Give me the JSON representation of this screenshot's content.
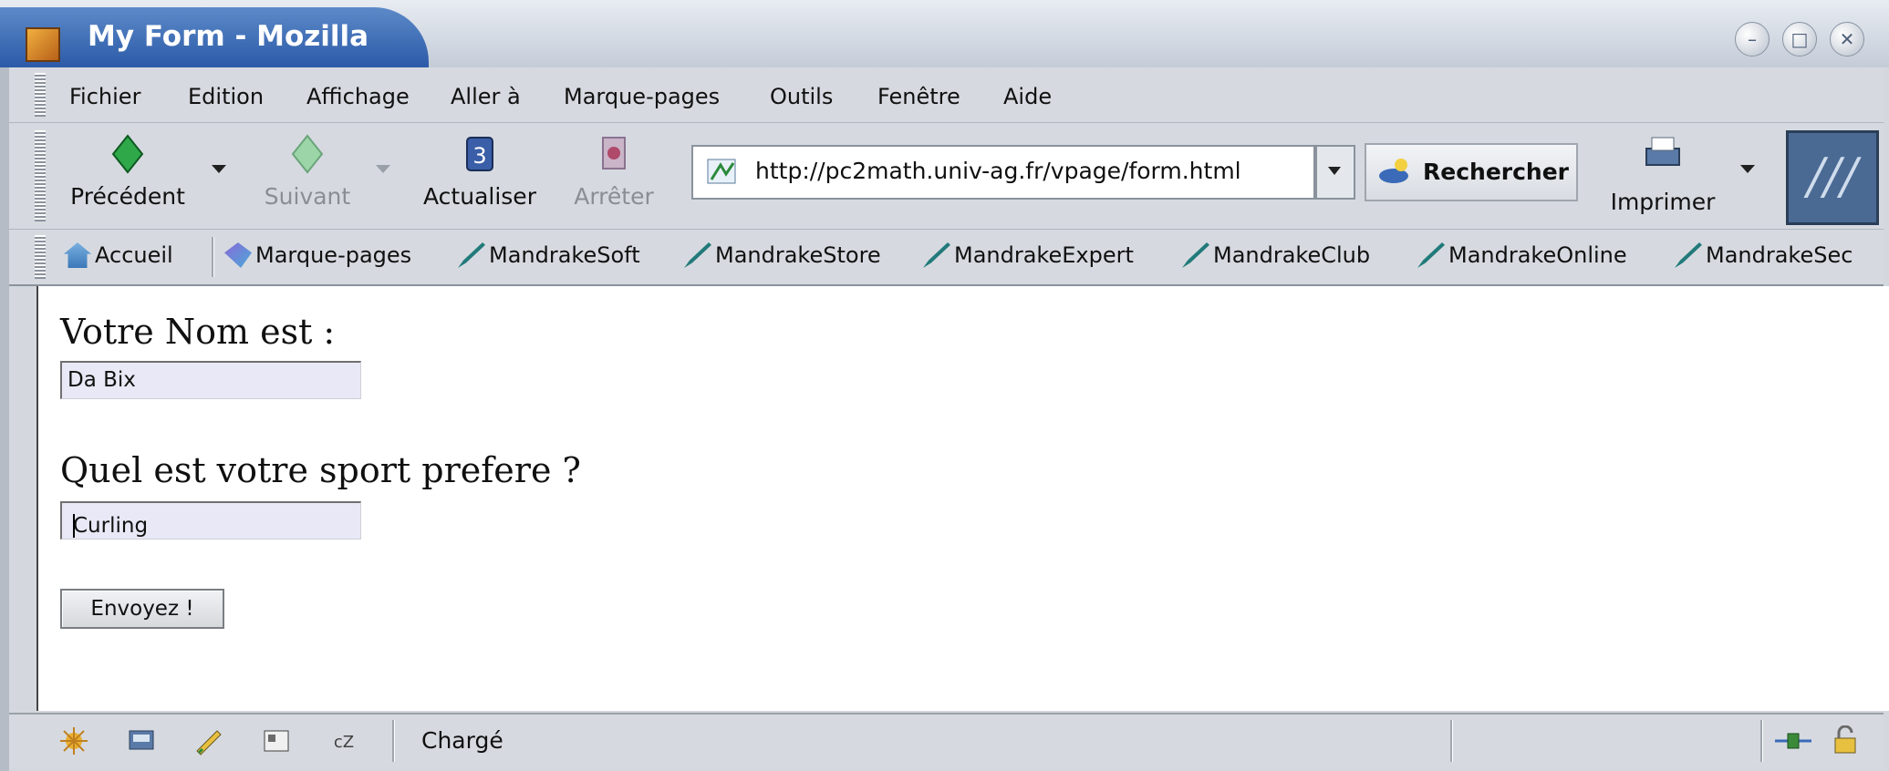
{
  "window": {
    "title": "My Form - Mozilla"
  },
  "menu": [
    "Fichier",
    "Edition",
    "Affichage",
    "Aller à",
    "Marque-pages",
    "Outils",
    "Fenêtre",
    "Aide"
  ],
  "toolbar": {
    "back": "Précédent",
    "forward": "Suivant",
    "reload": "Actualiser",
    "stop": "Arrêter",
    "url": "http://pc2math.univ-ag.fr/vpage/form.html",
    "search": "Rechercher",
    "print": "Imprimer"
  },
  "bookmarks": [
    "Accueil",
    "Marque-pages",
    "MandrakeSoft",
    "MandrakeStore",
    "MandrakeExpert",
    "MandrakeClub",
    "MandrakeOnline",
    "MandrakeSec"
  ],
  "form": {
    "name_label": "Votre Nom est :",
    "name_value": "Da Bix",
    "sport_label": "Quel est votre sport prefere ?",
    "sport_value": "Curling",
    "submit": "Envoyez !"
  },
  "status": {
    "text": "Chargé"
  },
  "colors": {
    "title_bar": "#2c5aa8",
    "field_bg": "#e8e8f6",
    "chrome": "#d6dae0"
  }
}
